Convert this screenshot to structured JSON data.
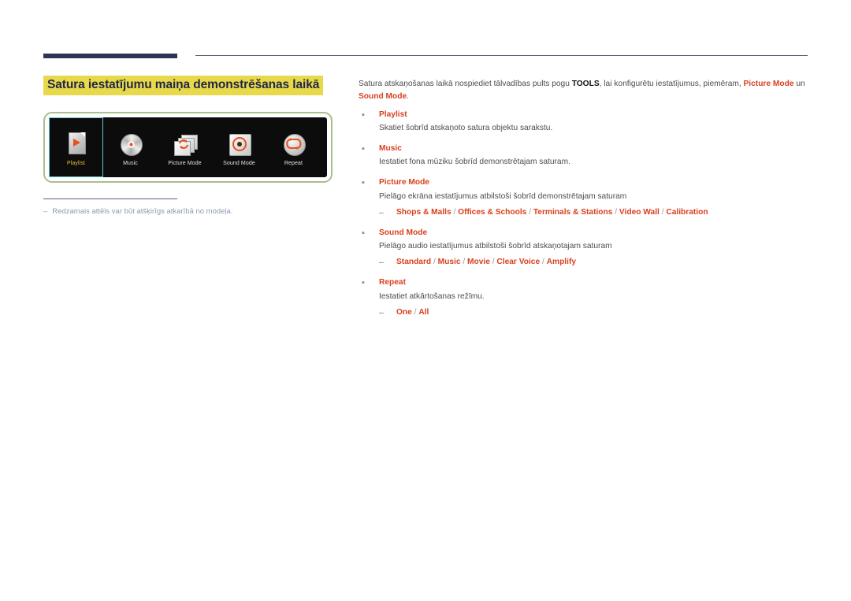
{
  "header": {
    "rule_thick_color": "#2d3454",
    "rule_thin_color": "#5b5f74"
  },
  "left": {
    "page_title": "Satura iestatījumu maiņa demonstrēšanas laikā",
    "title_highlight_color": "#e8d94a",
    "title_text_color": "#1f2747",
    "tv_frame_border_color": "#a9bf8e",
    "screen_items": [
      {
        "icon": "playlist-document-play-icon",
        "label": "Playlist",
        "selected": true
      },
      {
        "icon": "music-cd-disc-icon",
        "label": "Music",
        "selected": false
      },
      {
        "icon": "picture-mode-stacked-cards-refresh-icon",
        "label": "Picture Mode",
        "selected": false
      },
      {
        "icon": "sound-mode-speaker-ring-icon",
        "label": "Sound Mode",
        "selected": false
      },
      {
        "icon": "repeat-loop-icon",
        "label": "Repeat",
        "selected": false
      }
    ],
    "footnote": {
      "dash": "‒",
      "text": "Redzamais attēls var būt atšķirīgs atkarībā no modeļa."
    }
  },
  "right": {
    "intro": {
      "part1": "Satura atskaņošanas laikā nospiediet tālvadības pults pogu ",
      "tools": "TOOLS",
      "part2": ", lai konfigurētu iestatījumus, piemēram, ",
      "picture_mode": "Picture Mode",
      "part3": " un ",
      "sound_mode": "Sound Mode",
      "part4": "."
    },
    "accent_color": "#d8401e",
    "bullet_marker": "▪",
    "sub_dash": "‒",
    "items": [
      {
        "title": "Playlist",
        "desc": "Skatiet šobrīd atskaņoto satura objektu sarakstu.",
        "options": []
      },
      {
        "title": "Music",
        "desc": "Iestatiet fona mūziku šobrīd demonstrētajam saturam.",
        "options": []
      },
      {
        "title": "Picture Mode",
        "desc": "Pielāgo ekrāna iestatījumus atbilstoši šobrīd demonstrētajam saturam",
        "options": [
          "Shops & Malls",
          "Offices & Schools",
          "Terminals & Stations",
          "Video Wall",
          "Calibration"
        ]
      },
      {
        "title": "Sound Mode",
        "desc": "Pielāgo audio iestatījumus atbilstoši šobrīd atskaņotajam saturam",
        "options": [
          "Standard",
          "Music",
          "Movie",
          "Clear Voice",
          "Amplify"
        ]
      },
      {
        "title": "Repeat",
        "desc": "Iestatiet atkārtošanas režīmu.",
        "options": [
          "One",
          "All"
        ]
      }
    ]
  }
}
